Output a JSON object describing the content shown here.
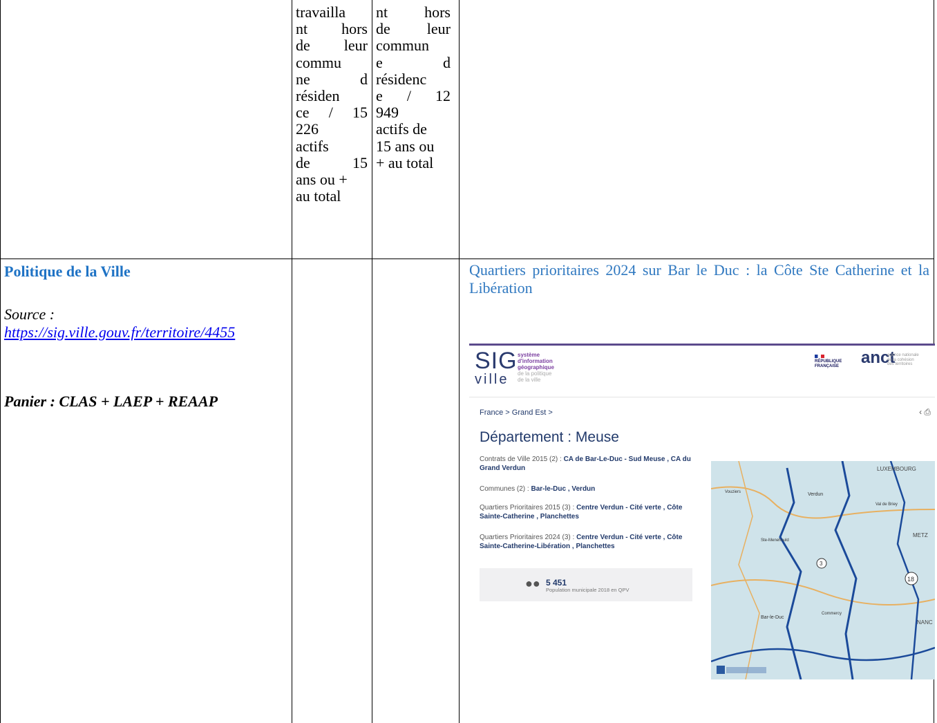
{
  "row1": {
    "col2_lines": [
      "travailla",
      "nt hors",
      "de leur",
      "commu",
      "ne d",
      "résiden",
      "ce / 15",
      "226",
      "actifs",
      "de 15",
      "ans ou +",
      "au total"
    ],
    "col3_lines": [
      "nt hors",
      "de leur",
      "commun",
      "e d",
      "résidenc",
      "e / 12",
      "949",
      "actifs de",
      "15 ans ou",
      "+ au total"
    ]
  },
  "row2": {
    "heading": "Politique de la Ville",
    "source_label": "Source :",
    "source_link": "https://sig.ville.gouv.fr/territoire/4455",
    "panier": "Panier : CLAS + LAEP + REAAP",
    "caption": "Quartiers prioritaires 2024 sur Bar le Duc : la Côte Ste Catherine et la Libération"
  },
  "screenshot": {
    "logo_main": "SIG",
    "logo_sub": "ville",
    "desc": [
      "système",
      "d'information",
      "géographique",
      "de la politique",
      "de la ville"
    ],
    "rf_lines": [
      "RÉPUBLIQUE",
      "FRANÇAISE"
    ],
    "anct_logo": "anct",
    "anct_sub": [
      "agence nationale",
      "de la cohésion",
      "des territoires"
    ],
    "breadcrumb": "France > Grand Est >",
    "title": "Département : Meuse",
    "contrats_label": "Contrats de Ville 2015 (2) : ",
    "contrats_value": "CA de Bar-Le-Duc - Sud Meuse , CA du Grand Verdun",
    "communes_label": "Communes (2) : ",
    "communes_value": "Bar-le-Duc , Verdun",
    "qp2015_label": "Quartiers Prioritaires 2015 (3) : ",
    "qp2015_value": "Centre Verdun - Cité verte , Côte Sainte-Catherine , Planchettes",
    "qp2024_label": "Quartiers Prioritaires 2024 (3) : ",
    "qp2024_value": "Centre Verdun - Cité verte , Côte Sainte-Catherine-Libération , Planchettes",
    "population_value": "5 451",
    "population_label": "Population municipale 2018 en QPV",
    "map_labels": {
      "luxembourg": "LUXEMBOURG",
      "metz": "METZ",
      "nanc": "NANC",
      "bar_le_duc": "Bar-le-Duc",
      "verdun": "Verdun",
      "ste_menehould": "Ste-Menehould",
      "commercy": "Commercy",
      "val_de_briey": "Val de Briey",
      "vouziers": "Vouziers",
      "num3": "3",
      "num18": "18"
    }
  }
}
